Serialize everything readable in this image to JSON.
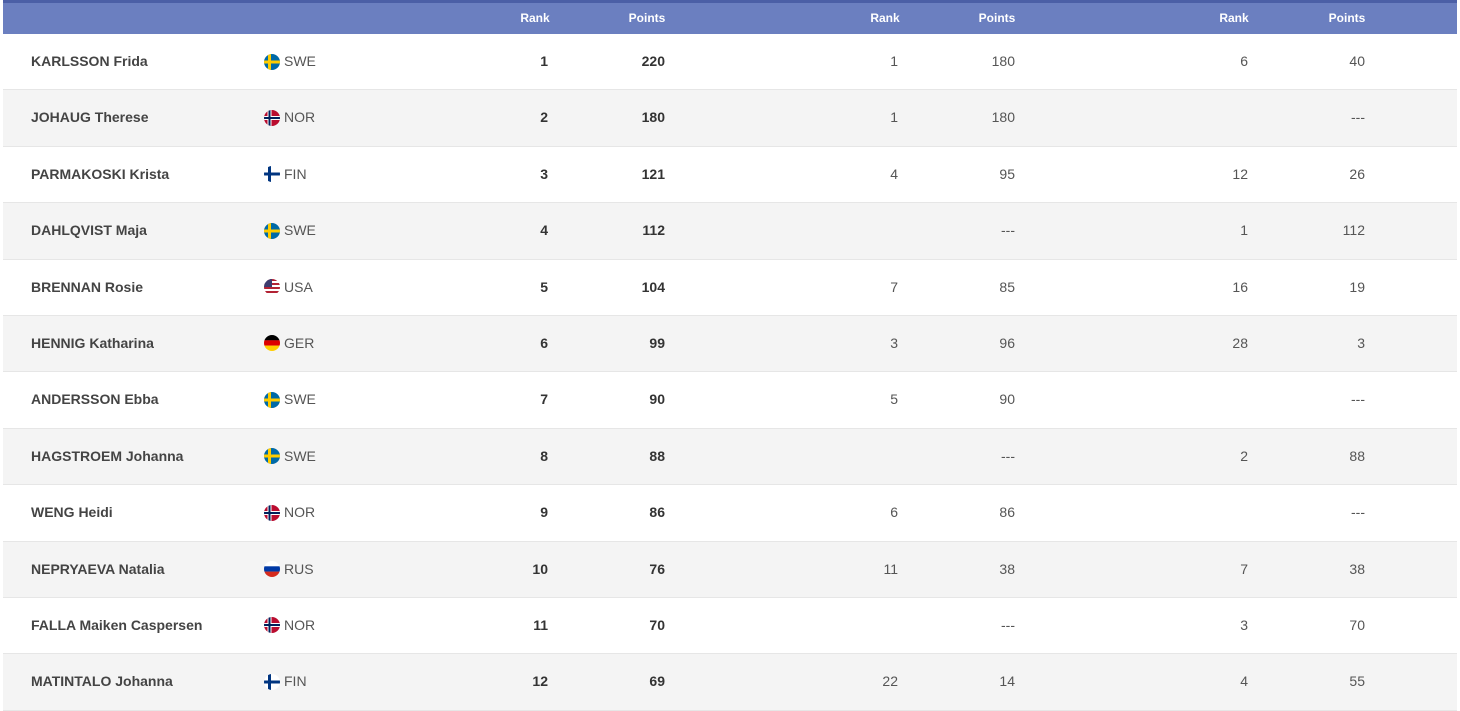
{
  "header": {
    "groups": [
      {
        "rank": "Rank",
        "points": "Points"
      },
      {
        "rank": "Rank",
        "points": "Points"
      },
      {
        "rank": "Rank",
        "points": "Points"
      }
    ]
  },
  "rows": [
    {
      "name": "KARLSSON Frida",
      "nation": "SWE",
      "rank": "1",
      "points": "220",
      "d1_rank": "1",
      "d1_points": "180",
      "d2_rank": "6",
      "d2_points": "40"
    },
    {
      "name": "JOHAUG Therese",
      "nation": "NOR",
      "rank": "2",
      "points": "180",
      "d1_rank": "1",
      "d1_points": "180",
      "d2_rank": "",
      "d2_points": "---"
    },
    {
      "name": "PARMAKOSKI Krista",
      "nation": "FIN",
      "rank": "3",
      "points": "121",
      "d1_rank": "4",
      "d1_points": "95",
      "d2_rank": "12",
      "d2_points": "26"
    },
    {
      "name": "DAHLQVIST Maja",
      "nation": "SWE",
      "rank": "4",
      "points": "112",
      "d1_rank": "",
      "d1_points": "---",
      "d2_rank": "1",
      "d2_points": "112"
    },
    {
      "name": "BRENNAN Rosie",
      "nation": "USA",
      "rank": "5",
      "points": "104",
      "d1_rank": "7",
      "d1_points": "85",
      "d2_rank": "16",
      "d2_points": "19"
    },
    {
      "name": "HENNIG Katharina",
      "nation": "GER",
      "rank": "6",
      "points": "99",
      "d1_rank": "3",
      "d1_points": "96",
      "d2_rank": "28",
      "d2_points": "3"
    },
    {
      "name": "ANDERSSON Ebba",
      "nation": "SWE",
      "rank": "7",
      "points": "90",
      "d1_rank": "5",
      "d1_points": "90",
      "d2_rank": "",
      "d2_points": "---"
    },
    {
      "name": "HAGSTROEM Johanna",
      "nation": "SWE",
      "rank": "8",
      "points": "88",
      "d1_rank": "",
      "d1_points": "---",
      "d2_rank": "2",
      "d2_points": "88"
    },
    {
      "name": "WENG Heidi",
      "nation": "NOR",
      "rank": "9",
      "points": "86",
      "d1_rank": "6",
      "d1_points": "86",
      "d2_rank": "",
      "d2_points": "---"
    },
    {
      "name": "NEPRYAEVA Natalia",
      "nation": "RUS",
      "rank": "10",
      "points": "76",
      "d1_rank": "11",
      "d1_points": "38",
      "d2_rank": "7",
      "d2_points": "38"
    },
    {
      "name": "FALLA Maiken Caspersen",
      "nation": "NOR",
      "rank": "11",
      "points": "70",
      "d1_rank": "",
      "d1_points": "---",
      "d2_rank": "3",
      "d2_points": "70"
    },
    {
      "name": "MATINTALO Johanna",
      "nation": "FIN",
      "rank": "12",
      "points": "69",
      "d1_rank": "22",
      "d1_points": "14",
      "d2_rank": "4",
      "d2_points": "55"
    }
  ]
}
